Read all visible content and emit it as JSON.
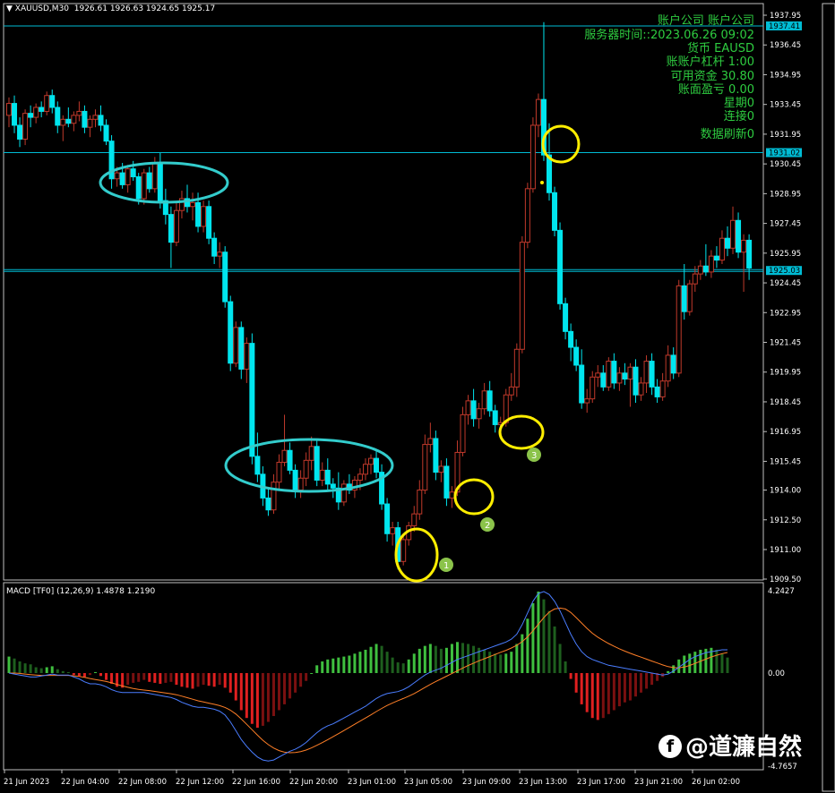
{
  "header": {
    "title": "XAUUSD,M30",
    "ohlc": "1926.61 1926.63 1924.65 1925.17"
  },
  "info_panel": {
    "line1": "账户公司 账户公司",
    "line2": "服务器时间::2023.06.26 09:02",
    "line3": "货币 EAUSD",
    "line4": "账账户杠杆 1:00",
    "line5": "可用资金 30.80",
    "line6": "账面盈亏 0.00",
    "line7": "星期0",
    "line8": "连接0",
    "line9": "数据刷新0"
  },
  "macd": {
    "label": "MACD [TF0] (12,26,9) 1.4878 1.2190",
    "ymax": "4.2427",
    "zero": "0.00",
    "ymin": "-4.7657"
  },
  "watermark": "@道濂自然",
  "colors": {
    "bull": "#00e5ee",
    "bear": "#c0392b",
    "hline": "#00bcd4",
    "ellipse_cyan": "#33cccc",
    "ellipse_yellow": "#ffee00",
    "badge": "#8bc34a",
    "hist_pos": "#3fbf3f",
    "hist_neg": "#e02020",
    "macd_line": "#4a7dff",
    "signal_line": "#ff7f27"
  },
  "chart_data": {
    "type": "candlestick",
    "symbol": "XAUUSD",
    "timeframe": "M30",
    "ylim": [
      1909.5,
      1938.5
    ],
    "yticks": [
      "1937.95",
      "1936.45",
      "1934.95",
      "1933.45",
      "1931.95",
      "1930.45",
      "1928.95",
      "1927.45",
      "1925.95",
      "1924.45",
      "1922.95",
      "1921.45",
      "1919.95",
      "1918.45",
      "1916.95",
      "1915.45",
      "1914.00",
      "1912.50",
      "1911.00",
      "1909.50"
    ],
    "xticks": [
      "21 Jun 2023",
      "22 Jun 04:00",
      "22 Jun 08:00",
      "22 Jun 12:00",
      "22 Jun 16:00",
      "22 Jun 20:00",
      "23 Jun 01:00",
      "23 Jun 05:00",
      "23 Jun 09:00",
      "23 Jun 13:00",
      "23 Jun 17:00",
      "23 Jun 21:00",
      "26 Jun 02:00"
    ],
    "price_tags": [
      "1937.41",
      "1931.02",
      "1925.03"
    ],
    "hlines": [
      1937.41,
      1931.02,
      1925.03
    ],
    "markers": [
      "1",
      "2",
      "3"
    ],
    "candles": [
      [
        1932.9,
        1933.8,
        1932.3,
        1933.5
      ],
      [
        1933.5,
        1933.9,
        1932.0,
        1932.4
      ],
      [
        1932.4,
        1932.8,
        1931.3,
        1931.7
      ],
      [
        1931.7,
        1933.2,
        1931.4,
        1933.0
      ],
      [
        1933.0,
        1933.4,
        1932.3,
        1932.8
      ],
      [
        1932.8,
        1933.5,
        1932.5,
        1933.3
      ],
      [
        1933.3,
        1933.6,
        1932.8,
        1933.1
      ],
      [
        1933.1,
        1934.1,
        1932.9,
        1933.9
      ],
      [
        1933.9,
        1934.2,
        1933.0,
        1933.3
      ],
      [
        1933.3,
        1933.6,
        1932.0,
        1932.4
      ],
      [
        1932.4,
        1932.9,
        1931.6,
        1932.7
      ],
      [
        1932.7,
        1933.3,
        1932.3,
        1932.5
      ],
      [
        1932.5,
        1933.1,
        1932.1,
        1932.9
      ],
      [
        1932.9,
        1933.6,
        1932.6,
        1933.1
      ],
      [
        1933.1,
        1933.4,
        1932.0,
        1932.3
      ],
      [
        1932.3,
        1932.9,
        1931.8,
        1932.7
      ],
      [
        1932.7,
        1933.2,
        1932.3,
        1932.9
      ],
      [
        1932.9,
        1933.4,
        1932.1,
        1932.4
      ],
      [
        1932.4,
        1932.7,
        1931.4,
        1931.6
      ],
      [
        1931.6,
        1931.9,
        1929.2,
        1929.7
      ],
      [
        1929.7,
        1930.3,
        1929.3,
        1930.0
      ],
      [
        1930.0,
        1930.5,
        1929.2,
        1929.4
      ],
      [
        1929.4,
        1930.4,
        1929.0,
        1930.2
      ],
      [
        1930.2,
        1930.6,
        1929.6,
        1929.8
      ],
      [
        1929.8,
        1930.0,
        1928.4,
        1928.7
      ],
      [
        1928.7,
        1930.2,
        1928.4,
        1930.0
      ],
      [
        1930.0,
        1930.3,
        1929.0,
        1929.2
      ],
      [
        1929.2,
        1930.8,
        1929.0,
        1930.5
      ],
      [
        1930.5,
        1931.0,
        1928.2,
        1928.6
      ],
      [
        1928.6,
        1929.2,
        1927.4,
        1927.9
      ],
      [
        1927.9,
        1928.3,
        1925.2,
        1926.5
      ],
      [
        1926.5,
        1928.5,
        1926.3,
        1928.1
      ],
      [
        1928.1,
        1929.1,
        1927.7,
        1928.7
      ],
      [
        1928.7,
        1929.4,
        1928.0,
        1928.3
      ],
      [
        1928.3,
        1929.0,
        1927.6,
        1928.5
      ],
      [
        1928.5,
        1929.0,
        1927.0,
        1927.3
      ],
      [
        1927.3,
        1928.6,
        1927.0,
        1928.3
      ],
      [
        1928.3,
        1928.6,
        1926.4,
        1926.7
      ],
      [
        1926.7,
        1927.0,
        1925.4,
        1925.8
      ],
      [
        1925.8,
        1926.5,
        1925.2,
        1926.0
      ],
      [
        1926.0,
        1926.3,
        1923.2,
        1923.5
      ],
      [
        1923.5,
        1923.8,
        1920.0,
        1920.4
      ],
      [
        1920.4,
        1922.5,
        1920.2,
        1922.2
      ],
      [
        1922.2,
        1922.5,
        1919.6,
        1920.1
      ],
      [
        1920.1,
        1921.7,
        1919.4,
        1921.4
      ],
      [
        1921.4,
        1921.9,
        1915.3,
        1915.7
      ],
      [
        1915.7,
        1916.9,
        1914.4,
        1914.8
      ],
      [
        1914.8,
        1915.2,
        1913.2,
        1913.6
      ],
      [
        1913.6,
        1914.1,
        1912.7,
        1913.0
      ],
      [
        1913.0,
        1914.8,
        1912.8,
        1914.4
      ],
      [
        1914.4,
        1915.8,
        1914.0,
        1915.4
      ],
      [
        1915.4,
        1917.8,
        1915.2,
        1916.0
      ],
      [
        1916.0,
        1916.4,
        1914.8,
        1915.0
      ],
      [
        1915.0,
        1915.3,
        1913.6,
        1914.0
      ],
      [
        1914.0,
        1915.0,
        1913.6,
        1914.6
      ],
      [
        1914.6,
        1915.9,
        1914.2,
        1915.5
      ],
      [
        1915.5,
        1916.7,
        1915.0,
        1916.2
      ],
      [
        1916.2,
        1916.6,
        1914.2,
        1914.5
      ],
      [
        1914.5,
        1915.4,
        1914.2,
        1915.0
      ],
      [
        1915.0,
        1915.6,
        1914.0,
        1914.3
      ],
      [
        1914.3,
        1914.6,
        1913.6,
        1914.1
      ],
      [
        1914.1,
        1914.9,
        1913.0,
        1913.4
      ],
      [
        1913.4,
        1914.5,
        1913.2,
        1914.3
      ],
      [
        1914.3,
        1914.8,
        1913.8,
        1914.0
      ],
      [
        1914.0,
        1914.7,
        1913.6,
        1914.5
      ],
      [
        1914.5,
        1915.1,
        1914.0,
        1914.8
      ],
      [
        1914.8,
        1915.6,
        1914.5,
        1915.3
      ],
      [
        1915.3,
        1915.8,
        1914.8,
        1915.6
      ],
      [
        1915.6,
        1916.0,
        1914.6,
        1914.9
      ],
      [
        1914.9,
        1915.3,
        1913.0,
        1913.3
      ],
      [
        1913.3,
        1913.6,
        1911.4,
        1911.8
      ],
      [
        1911.8,
        1912.4,
        1911.2,
        1912.1
      ],
      [
        1912.1,
        1912.4,
        1910.0,
        1910.4
      ],
      [
        1910.4,
        1911.8,
        1910.2,
        1911.5
      ],
      [
        1911.5,
        1912.4,
        1911.2,
        1912.2
      ],
      [
        1912.2,
        1913.2,
        1911.9,
        1912.8
      ],
      [
        1912.8,
        1914.5,
        1912.5,
        1914.0
      ],
      [
        1914.0,
        1916.8,
        1913.8,
        1916.3
      ],
      [
        1916.3,
        1917.4,
        1915.9,
        1916.6
      ],
      [
        1916.6,
        1917.0,
        1914.5,
        1914.9
      ],
      [
        1914.9,
        1915.5,
        1914.4,
        1915.2
      ],
      [
        1915.2,
        1915.6,
        1913.2,
        1913.6
      ],
      [
        1913.6,
        1914.2,
        1913.1,
        1913.9
      ],
      [
        1913.9,
        1916.5,
        1913.7,
        1915.9
      ],
      [
        1915.9,
        1918.2,
        1915.7,
        1917.8
      ],
      [
        1917.8,
        1918.8,
        1917.3,
        1918.5
      ],
      [
        1918.5,
        1919.1,
        1917.2,
        1917.6
      ],
      [
        1917.6,
        1918.4,
        1917.1,
        1918.1
      ],
      [
        1918.1,
        1919.4,
        1917.8,
        1919.0
      ],
      [
        1919.0,
        1919.5,
        1917.7,
        1918.0
      ],
      [
        1918.0,
        1918.3,
        1916.9,
        1917.3
      ],
      [
        1917.3,
        1917.7,
        1916.7,
        1917.4
      ],
      [
        1917.4,
        1919.1,
        1917.2,
        1918.8
      ],
      [
        1918.8,
        1919.9,
        1918.5,
        1919.2
      ],
      [
        1919.2,
        1921.4,
        1918.7,
        1921.1
      ],
      [
        1921.1,
        1926.8,
        1920.9,
        1926.5
      ],
      [
        1926.5,
        1929.5,
        1926.2,
        1929.2
      ],
      [
        1929.2,
        1932.8,
        1929.0,
        1932.4
      ],
      [
        1932.4,
        1934.0,
        1931.8,
        1933.7
      ],
      [
        1933.7,
        1937.6,
        1930.6,
        1930.9
      ],
      [
        1930.9,
        1932.5,
        1928.6,
        1929.0
      ],
      [
        1929.0,
        1929.3,
        1926.8,
        1927.1
      ],
      [
        1927.1,
        1927.5,
        1923.1,
        1923.4
      ],
      [
        1923.4,
        1923.7,
        1921.6,
        1922.0
      ],
      [
        1922.0,
        1922.4,
        1920.5,
        1921.2
      ],
      [
        1921.2,
        1921.6,
        1920.0,
        1920.3
      ],
      [
        1920.3,
        1921.1,
        1918.1,
        1918.4
      ],
      [
        1918.4,
        1919.1,
        1917.9,
        1918.6
      ],
      [
        1918.6,
        1920.0,
        1918.4,
        1919.7
      ],
      [
        1919.7,
        1920.3,
        1919.2,
        1919.9
      ],
      [
        1919.9,
        1920.3,
        1919.0,
        1919.2
      ],
      [
        1919.2,
        1920.7,
        1919.0,
        1920.5
      ],
      [
        1920.5,
        1920.9,
        1919.1,
        1919.4
      ],
      [
        1919.4,
        1920.2,
        1919.0,
        1919.9
      ],
      [
        1919.9,
        1920.4,
        1919.3,
        1919.6
      ],
      [
        1919.6,
        1920.4,
        1918.2,
        1920.2
      ],
      [
        1920.2,
        1920.6,
        1918.4,
        1918.8
      ],
      [
        1918.8,
        1919.7,
        1918.5,
        1919.4
      ],
      [
        1919.4,
        1920.8,
        1918.9,
        1920.5
      ],
      [
        1920.5,
        1920.9,
        1918.8,
        1919.2
      ],
      [
        1919.2,
        1919.6,
        1918.4,
        1918.7
      ],
      [
        1918.7,
        1919.9,
        1918.5,
        1919.5
      ],
      [
        1919.5,
        1921.3,
        1919.2,
        1920.8
      ],
      [
        1920.8,
        1921.2,
        1919.6,
        1919.9
      ],
      [
        1919.9,
        1924.6,
        1919.7,
        1924.3
      ],
      [
        1924.3,
        1925.4,
        1922.6,
        1923.0
      ],
      [
        1923.0,
        1924.6,
        1922.8,
        1924.4
      ],
      [
        1924.4,
        1925.3,
        1924.0,
        1924.9
      ],
      [
        1924.9,
        1925.6,
        1924.6,
        1925.3
      ],
      [
        1925.3,
        1926.4,
        1924.8,
        1925.0
      ],
      [
        1925.0,
        1926.1,
        1924.7,
        1925.8
      ],
      [
        1925.8,
        1926.3,
        1925.2,
        1925.6
      ],
      [
        1925.6,
        1927.1,
        1925.4,
        1926.7
      ],
      [
        1926.7,
        1927.3,
        1925.8,
        1926.2
      ],
      [
        1926.2,
        1928.3,
        1925.9,
        1927.6
      ],
      [
        1927.6,
        1928.0,
        1925.7,
        1926.0
      ],
      [
        1926.0,
        1926.9,
        1924.0,
        1926.6
      ],
      [
        1926.6,
        1926.9,
        1924.6,
        1925.2
      ]
    ],
    "macd_hist": [
      0.85,
      0.75,
      0.6,
      0.5,
      0.45,
      0.3,
      0.25,
      0.3,
      0.35,
      0.2,
      0.1,
      0.05,
      -0.1,
      -0.15,
      -0.2,
      -0.1,
      0.05,
      -0.15,
      -0.35,
      -0.55,
      -0.7,
      -0.75,
      -0.6,
      -0.5,
      -0.45,
      -0.35,
      -0.45,
      -0.5,
      -0.55,
      -0.5,
      -0.45,
      -0.6,
      -0.7,
      -0.75,
      -0.8,
      -0.7,
      -0.6,
      -0.65,
      -0.7,
      -0.6,
      -0.75,
      -1.0,
      -1.4,
      -1.9,
      -2.3,
      -2.6,
      -2.8,
      -2.7,
      -2.5,
      -2.2,
      -1.9,
      -1.6,
      -1.3,
      -1.0,
      -0.7,
      -0.4,
      0.0,
      0.4,
      0.6,
      0.7,
      0.75,
      0.8,
      0.85,
      0.9,
      1.0,
      1.1,
      1.2,
      1.35,
      1.5,
      1.4,
      1.1,
      0.8,
      0.55,
      0.5,
      0.7,
      1.0,
      1.25,
      1.4,
      1.5,
      1.4,
      1.25,
      1.3,
      1.5,
      1.6,
      1.55,
      1.5,
      1.4,
      1.3,
      1.2,
      1.1,
      1.0,
      0.95,
      1.0,
      1.1,
      1.5,
      2.0,
      2.8,
      3.6,
      4.2,
      3.8,
      3.2,
      2.4,
      1.5,
      0.6,
      -0.3,
      -1.0,
      -1.6,
      -2.0,
      -2.3,
      -2.4,
      -2.3,
      -2.1,
      -1.9,
      -1.7,
      -1.5,
      -1.4,
      -1.2,
      -1.0,
      -0.8,
      -0.6,
      -0.4,
      -0.2,
      0.1,
      0.4,
      0.7,
      0.9,
      1.0,
      1.1,
      1.2,
      1.25,
      1.3,
      1.2,
      1.0,
      0.8
    ],
    "macd_line": [
      0.0,
      -0.05,
      -0.1,
      -0.15,
      -0.2,
      -0.2,
      -0.15,
      -0.1,
      -0.05,
      -0.1,
      -0.1,
      -0.1,
      -0.2,
      -0.3,
      -0.45,
      -0.55,
      -0.55,
      -0.6,
      -0.7,
      -0.85,
      -0.95,
      -1.0,
      -1.0,
      -1.0,
      -1.0,
      -1.0,
      -1.05,
      -1.1,
      -1.15,
      -1.2,
      -1.25,
      -1.35,
      -1.5,
      -1.6,
      -1.7,
      -1.75,
      -1.75,
      -1.8,
      -1.85,
      -1.95,
      -2.15,
      -2.5,
      -2.95,
      -3.4,
      -3.75,
      -4.05,
      -4.3,
      -4.45,
      -4.5,
      -4.45,
      -4.3,
      -4.15,
      -4.0,
      -3.9,
      -3.75,
      -3.55,
      -3.3,
      -3.05,
      -2.85,
      -2.7,
      -2.6,
      -2.45,
      -2.3,
      -2.15,
      -2.0,
      -1.85,
      -1.7,
      -1.5,
      -1.3,
      -1.15,
      -1.05,
      -1.0,
      -0.95,
      -0.85,
      -0.7,
      -0.5,
      -0.3,
      -0.1,
      0.05,
      0.15,
      0.25,
      0.4,
      0.55,
      0.7,
      0.8,
      0.9,
      1.0,
      1.1,
      1.2,
      1.3,
      1.4,
      1.5,
      1.6,
      1.75,
      2.0,
      2.5,
      3.1,
      3.7,
      4.1,
      4.2,
      4.05,
      3.7,
      3.2,
      2.6,
      2.0,
      1.5,
      1.1,
      0.85,
      0.7,
      0.6,
      0.5,
      0.4,
      0.35,
      0.3,
      0.25,
      0.2,
      0.15,
      0.1,
      0.05,
      0.0,
      -0.05,
      -0.1,
      -0.05,
      0.1,
      0.3,
      0.5,
      0.7,
      0.85,
      0.95,
      1.05,
      1.1,
      1.15,
      1.2,
      1.2
    ],
    "signal_line": [
      0.0,
      0.0,
      -0.02,
      -0.05,
      -0.08,
      -0.1,
      -0.12,
      -0.12,
      -0.12,
      -0.12,
      -0.12,
      -0.12,
      -0.14,
      -0.17,
      -0.22,
      -0.28,
      -0.33,
      -0.38,
      -0.43,
      -0.5,
      -0.58,
      -0.66,
      -0.73,
      -0.79,
      -0.84,
      -0.87,
      -0.9,
      -0.94,
      -0.98,
      -1.02,
      -1.06,
      -1.11,
      -1.18,
      -1.26,
      -1.34,
      -1.42,
      -1.48,
      -1.54,
      -1.6,
      -1.67,
      -1.76,
      -1.9,
      -2.1,
      -2.35,
      -2.62,
      -2.9,
      -3.18,
      -3.44,
      -3.66,
      -3.84,
      -3.97,
      -4.05,
      -4.08,
      -4.07,
      -4.02,
      -3.94,
      -3.83,
      -3.7,
      -3.56,
      -3.41,
      -3.26,
      -3.1,
      -2.94,
      -2.78,
      -2.62,
      -2.46,
      -2.3,
      -2.14,
      -1.97,
      -1.81,
      -1.66,
      -1.53,
      -1.41,
      -1.3,
      -1.18,
      -1.05,
      -0.9,
      -0.74,
      -0.58,
      -0.43,
      -0.3,
      -0.16,
      -0.02,
      0.12,
      0.26,
      0.39,
      0.51,
      0.63,
      0.74,
      0.85,
      0.96,
      1.07,
      1.17,
      1.29,
      1.43,
      1.62,
      1.87,
      2.18,
      2.52,
      2.86,
      3.14,
      3.3,
      3.35,
      3.3,
      3.12,
      2.86,
      2.58,
      2.3,
      2.05,
      1.85,
      1.68,
      1.52,
      1.38,
      1.25,
      1.13,
      1.02,
      0.92,
      0.82,
      0.72,
      0.62,
      0.52,
      0.42,
      0.33,
      0.28,
      0.27,
      0.31,
      0.39,
      0.5,
      0.61,
      0.72,
      0.83,
      0.92,
      1.0,
      1.06
    ]
  }
}
